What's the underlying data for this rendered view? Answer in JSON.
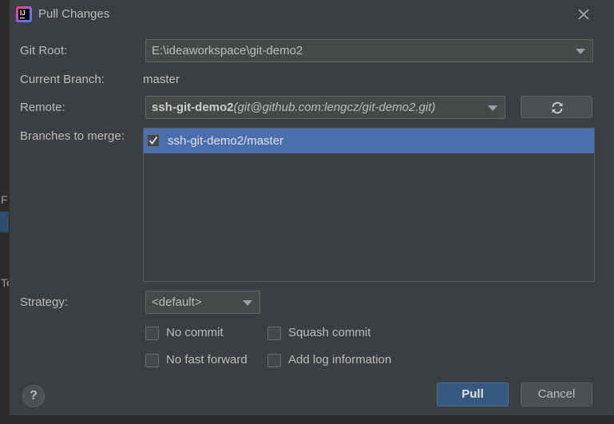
{
  "window": {
    "title": "Pull Changes",
    "icon": "intellij-idea-icon"
  },
  "background": {
    "fragment_1": "F",
    "fragment_2": "Te"
  },
  "form": {
    "git_root_label": "Git Root:",
    "git_root_value": "E:\\ideaworkspace\\git-demo2",
    "current_branch_label": "Current Branch:",
    "current_branch_value": "master",
    "remote_label": "Remote:",
    "remote_name": "ssh-git-demo2",
    "remote_url": "(git@github.com:lengcz/git-demo2.git)",
    "refresh_icon": "refresh-icon",
    "branches_label": "Branches to merge:",
    "branches": [
      {
        "name": "ssh-git-demo2/master",
        "checked": true,
        "selected": true
      }
    ],
    "strategy_label": "Strategy:",
    "strategy_value": "<default>",
    "options": {
      "no_commit": "No commit",
      "squash_commit": "Squash commit",
      "no_fast_forward": "No fast forward",
      "add_log_information": "Add log information"
    }
  },
  "footer": {
    "help_label": "?",
    "pull_label": "Pull",
    "cancel_label": "Cancel"
  },
  "colors": {
    "dialog_bg": "#3c3f41",
    "selection": "#4b6eaf",
    "default_button": "#365880",
    "text": "#bbbbbb"
  }
}
